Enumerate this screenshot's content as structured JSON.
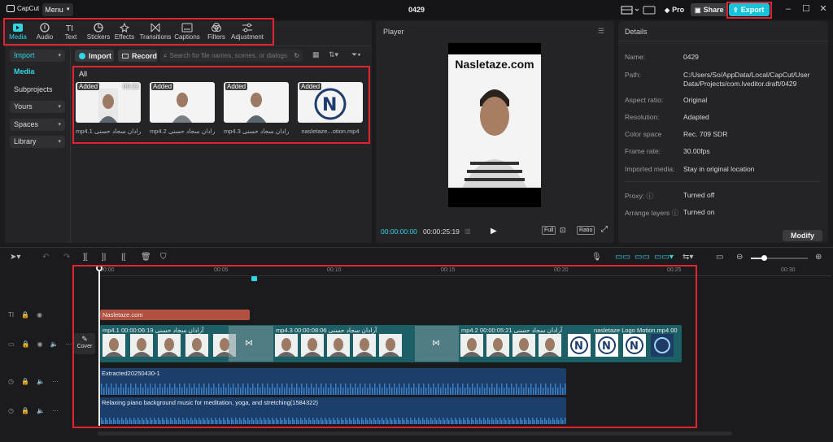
{
  "app": {
    "logo_text": "CapCut",
    "menu_label": "Menu",
    "project_title": "0429",
    "pro_label": "Pro",
    "share_label": "Share",
    "export_label": "Export"
  },
  "toolbar": {
    "items": [
      {
        "label": "Media",
        "icon": "media-icon",
        "active": true
      },
      {
        "label": "Audio",
        "icon": "audio-icon"
      },
      {
        "label": "Text",
        "icon": "text-icon"
      },
      {
        "label": "Stickers",
        "icon": "stickers-icon"
      },
      {
        "label": "Effects",
        "icon": "effects-icon"
      },
      {
        "label": "Transitions",
        "icon": "transitions-icon"
      },
      {
        "label": "Captions",
        "icon": "captions-icon"
      },
      {
        "label": "Filters",
        "icon": "filters-icon"
      },
      {
        "label": "Adjustment",
        "icon": "adjustment-icon"
      }
    ]
  },
  "sidebar": {
    "items": [
      {
        "label": "Import",
        "group": true,
        "active": true
      },
      {
        "label": "Media",
        "group": false
      },
      {
        "label": "Subprojects",
        "group": false
      },
      {
        "label": "Yours",
        "group": true
      },
      {
        "label": "Spaces",
        "group": true
      },
      {
        "label": "Library",
        "group": true
      }
    ]
  },
  "media_panel": {
    "import_label": "Import",
    "record_label": "Record",
    "search_placeholder": "Search for file names, scenes, or dialogs",
    "all_label": "All",
    "items": [
      {
        "badge": "Added",
        "duration": "00:21",
        "name": "mp4.1",
        "name_suffix": "آرادان سجاد حسنی"
      },
      {
        "badge": "Added",
        "duration": "",
        "name": "mp4.2",
        "name_suffix": "آرادان سجاد حسنی"
      },
      {
        "badge": "Added",
        "duration": "",
        "name": "mp4.3",
        "name_suffix": "آرادان سجاد حسنی"
      },
      {
        "badge": "Added",
        "duration": "",
        "name": "nasletaze...otion.mp4",
        "name_suffix": ""
      }
    ]
  },
  "player": {
    "title": "Player",
    "watermark": "Nasletaze.com",
    "current_time": "00:00:00:00",
    "total_time": "00:00:25:19",
    "full_label": "Full",
    "ratio_label": "Ratio"
  },
  "details": {
    "title": "Details",
    "rows": [
      {
        "label": "Name:",
        "value": "0429"
      },
      {
        "label": "Path:",
        "value": "C:/Users/So/AppData/Local/CapCut/User Data/Projects/com.lveditor.draft/0429"
      },
      {
        "label": "Aspect ratio:",
        "value": "Original"
      },
      {
        "label": "Resolution:",
        "value": "Adapted"
      },
      {
        "label": "Color space",
        "value": "Rec. 709 SDR"
      },
      {
        "label": "Frame rate:",
        "value": "30.00fps"
      },
      {
        "label": "Imported media:",
        "value": "Stay in original location"
      },
      {
        "label": "Proxy:",
        "value": "Turned off"
      },
      {
        "label": "Arrange layers",
        "value": "Turned on"
      }
    ],
    "modify_label": "Modify"
  },
  "timeline": {
    "ruler": [
      "00:00",
      "00:05",
      "00:10",
      "00:15",
      "00:20",
      "00:25",
      "00:30"
    ],
    "cover_label": "Cover",
    "text_clip": "Nasletaze.com",
    "video_clips": [
      {
        "name": "mp4.1",
        "suffix": "آرادان سجاد حسنی",
        "duration": "00:00:06:19"
      },
      {
        "name": "mp4.3",
        "suffix": "آرادان سجاد حسنی",
        "duration": "00:00:08:06"
      },
      {
        "name": "mp4.2",
        "suffix": "آرادان سجاد حسنی",
        "duration": "00:00:05:21"
      },
      {
        "name": "nasletaze Logo Motion.mp4",
        "suffix": "",
        "duration": "00"
      }
    ],
    "audio_clips": [
      {
        "name": "Extracted20250430-1"
      },
      {
        "name": "Relaxing piano background music for meditation, yoga, and stretching(1584322)"
      }
    ]
  },
  "colors": {
    "accent": "#2fd6e4",
    "highlight": "#e5232f",
    "export_bg": "#17c3d9",
    "text_clip": "#b0523f",
    "video_track": "#1d5f66",
    "audio_track": "#1b3e6b"
  }
}
